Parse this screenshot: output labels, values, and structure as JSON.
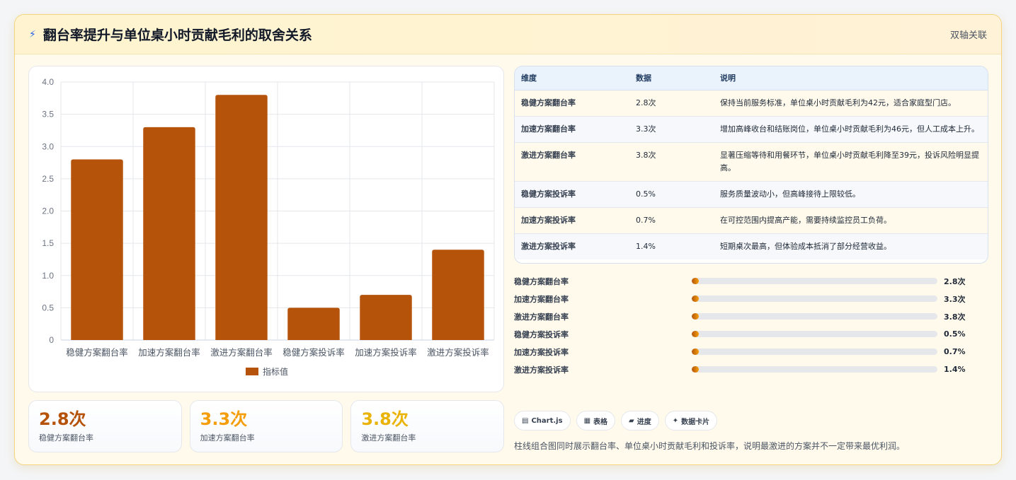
{
  "header": {
    "icon": "lightning-icon",
    "title": "翻台率提升与单位桌小时贡献毛利的取舍关系",
    "tag": "双轴关联"
  },
  "chart_data": {
    "type": "bar",
    "categories": [
      "稳健方案翻台率",
      "加速方案翻台率",
      "激进方案翻台率",
      "稳健方案投诉率",
      "加速方案投诉率",
      "激进方案投诉率"
    ],
    "series": [
      {
        "name": "指标值",
        "values": [
          2.8,
          3.3,
          3.8,
          0.5,
          0.7,
          1.4
        ]
      }
    ],
    "ylim": [
      0,
      4
    ],
    "yticks": [
      "0",
      "0.5",
      "1.0",
      "1.5",
      "2.0",
      "2.5",
      "3.0",
      "3.5",
      "4.0"
    ],
    "grid": true,
    "legend": "bottom",
    "bar_color": "#b45309"
  },
  "stats": [
    {
      "value": "2.8次",
      "label": "稳健方案翻台率",
      "color": "#b45309"
    },
    {
      "value": "3.3次",
      "label": "加速方案翻台率",
      "color": "#f59e0b"
    },
    {
      "value": "3.8次",
      "label": "激进方案翻台率",
      "color": "#eab308"
    }
  ],
  "table": {
    "headers": [
      "维度",
      "数据",
      "说明"
    ],
    "rows": [
      {
        "dim": "稳健方案翻台率",
        "value": "2.8次",
        "desc": "保持当前服务标准，单位桌小时贡献毛利为42元，适合家庭型门店。"
      },
      {
        "dim": "加速方案翻台率",
        "value": "3.3次",
        "desc": "增加高峰收台和结账岗位，单位桌小时贡献毛利为46元，但人工成本上升。"
      },
      {
        "dim": "激进方案翻台率",
        "value": "3.8次",
        "desc": "显著压缩等待和用餐环节，单位桌小时贡献毛利降至39元，投诉风险明显提高。"
      },
      {
        "dim": "稳健方案投诉率",
        "value": "0.5%",
        "desc": "服务质量波动小，但高峰接待上限较低。"
      },
      {
        "dim": "加速方案投诉率",
        "value": "0.7%",
        "desc": "在可控范围内提高产能，需要持续监控员工负荷。"
      },
      {
        "dim": "激进方案投诉率",
        "value": "1.4%",
        "desc": "短期桌次最高，但体验成本抵消了部分经营收益。"
      }
    ]
  },
  "progress": [
    {
      "label": "稳健方案翻台率",
      "value": "2.8次",
      "fill": 0.03
    },
    {
      "label": "加速方案翻台率",
      "value": "3.3次",
      "fill": 0.03
    },
    {
      "label": "激进方案翻台率",
      "value": "3.8次",
      "fill": 0.03
    },
    {
      "label": "稳健方案投诉率",
      "value": "0.5%",
      "fill": 0.03
    },
    {
      "label": "加速方案投诉率",
      "value": "0.7%",
      "fill": 0.03
    },
    {
      "label": "激进方案投诉率",
      "value": "1.4%",
      "fill": 0.03
    }
  ],
  "chips": [
    {
      "icon": "chart-icon",
      "glyph": "▤",
      "label": "Chart.js"
    },
    {
      "icon": "table-icon",
      "glyph": "▦",
      "label": "表格"
    },
    {
      "icon": "progress-icon",
      "glyph": "▰",
      "label": "进度"
    },
    {
      "icon": "card-icon",
      "glyph": "✦",
      "label": "数据卡片"
    }
  ],
  "note": "柱线组合图同时展示翻台率、单位桌小时贡献毛利和投诉率，说明最激进的方案并不一定带来最优利润。"
}
